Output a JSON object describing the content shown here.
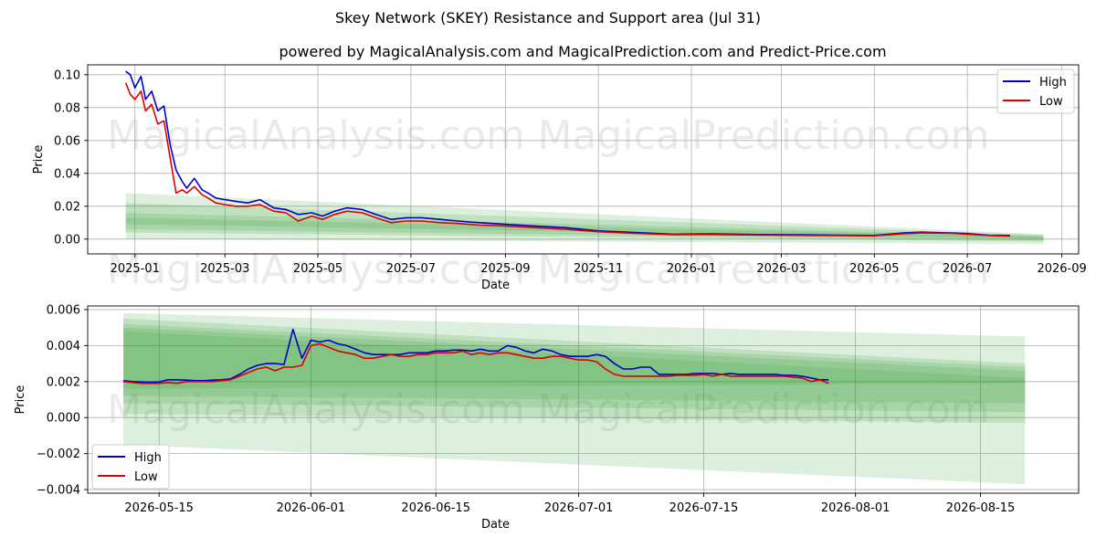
{
  "title": "Skey Network (SKEY) Resistance and Support area (Jul 31)",
  "subtitle": "powered by MagicalAnalysis.com and MagicalPrediction.com and Predict-Price.com",
  "watermarks": [
    "MagicalAnalysis.com",
    "MagicalPrediction.com"
  ],
  "colors": {
    "high": "#0000cc",
    "low": "#dd0000",
    "band": "#2e9a2e",
    "grid": "#b0b0b0"
  },
  "chart_data": [
    {
      "type": "line",
      "xlabel": "Date",
      "ylabel": "Price",
      "xlim": [
        "2024-12-01",
        "2026-09-12"
      ],
      "ylim": [
        -0.009,
        0.106
      ],
      "x_ticks": [
        "2025-01-01",
        "2025-03-01",
        "2025-05-01",
        "2025-07-01",
        "2025-09-01",
        "2025-11-01",
        "2026-01-01",
        "2026-03-01",
        "2026-05-01",
        "2026-07-01",
        "2026-09-01"
      ],
      "x_tick_labels": [
        "2025-01",
        "2025-03",
        "2025-05",
        "2025-07",
        "2025-09",
        "2025-11",
        "2026-01",
        "2026-03",
        "2026-05",
        "2026-07",
        "2026-09"
      ],
      "y_ticks": [
        0.0,
        0.02,
        0.04,
        0.06,
        0.08,
        0.1
      ],
      "y_tick_labels": [
        "0.00",
        "0.02",
        "0.04",
        "0.06",
        "0.08",
        "0.10"
      ],
      "grid": true,
      "legend": "upper right",
      "series": [
        {
          "name": "High",
          "color": "#0000cc",
          "x": [
            "2024-12-26",
            "2024-12-29",
            "2025-01-01",
            "2025-01-05",
            "2025-01-08",
            "2025-01-12",
            "2025-01-16",
            "2025-01-20",
            "2025-01-24",
            "2025-01-28",
            "2025-02-01",
            "2025-02-04",
            "2025-02-09",
            "2025-02-14",
            "2025-02-18",
            "2025-02-23",
            "2025-03-01",
            "2025-03-08",
            "2025-03-16",
            "2025-03-24",
            "2025-04-02",
            "2025-04-10",
            "2025-04-18",
            "2025-04-27",
            "2025-05-04",
            "2025-05-12",
            "2025-05-20",
            "2025-05-30",
            "2025-06-08",
            "2025-06-18",
            "2025-06-28",
            "2025-07-08",
            "2025-07-20",
            "2025-08-01",
            "2025-08-15",
            "2025-09-01",
            "2025-09-20",
            "2025-10-10",
            "2025-11-01",
            "2025-11-25",
            "2025-12-20",
            "2026-01-15",
            "2026-02-15",
            "2026-03-15",
            "2026-04-10",
            "2026-05-01",
            "2026-05-20",
            "2026-06-01",
            "2026-06-20",
            "2026-07-01",
            "2026-07-15",
            "2026-07-29"
          ],
          "values": [
            0.102,
            0.1,
            0.092,
            0.099,
            0.085,
            0.09,
            0.078,
            0.081,
            0.058,
            0.042,
            0.035,
            0.031,
            0.037,
            0.03,
            0.028,
            0.025,
            0.024,
            0.023,
            0.022,
            0.024,
            0.019,
            0.018,
            0.015,
            0.016,
            0.014,
            0.017,
            0.019,
            0.018,
            0.015,
            0.012,
            0.013,
            0.013,
            0.012,
            0.011,
            0.01,
            0.009,
            0.008,
            0.007,
            0.005,
            0.004,
            0.003,
            0.0032,
            0.0028,
            0.0026,
            0.0024,
            0.0022,
            0.0038,
            0.0042,
            0.0038,
            0.0034,
            0.0024,
            0.0022
          ]
        },
        {
          "name": "Low",
          "color": "#dd0000",
          "x": [
            "2024-12-26",
            "2024-12-29",
            "2025-01-01",
            "2025-01-05",
            "2025-01-08",
            "2025-01-12",
            "2025-01-16",
            "2025-01-20",
            "2025-01-24",
            "2025-01-28",
            "2025-02-01",
            "2025-02-04",
            "2025-02-09",
            "2025-02-14",
            "2025-02-18",
            "2025-02-23",
            "2025-03-01",
            "2025-03-08",
            "2025-03-16",
            "2025-03-24",
            "2025-04-02",
            "2025-04-10",
            "2025-04-18",
            "2025-04-27",
            "2025-05-04",
            "2025-05-12",
            "2025-05-20",
            "2025-05-30",
            "2025-06-08",
            "2025-06-18",
            "2025-06-28",
            "2025-07-08",
            "2025-07-20",
            "2025-08-01",
            "2025-08-15",
            "2025-09-01",
            "2025-09-20",
            "2025-10-10",
            "2025-11-01",
            "2025-11-25",
            "2025-12-20",
            "2026-01-15",
            "2026-02-15",
            "2026-03-15",
            "2026-04-10",
            "2026-05-01",
            "2026-05-20",
            "2026-06-01",
            "2026-06-20",
            "2026-07-01",
            "2026-07-15",
            "2026-07-29"
          ],
          "values": [
            0.095,
            0.088,
            0.085,
            0.09,
            0.078,
            0.082,
            0.07,
            0.072,
            0.05,
            0.028,
            0.03,
            0.028,
            0.032,
            0.027,
            0.025,
            0.022,
            0.021,
            0.02,
            0.02,
            0.021,
            0.017,
            0.016,
            0.011,
            0.014,
            0.012,
            0.015,
            0.017,
            0.016,
            0.013,
            0.01,
            0.011,
            0.011,
            0.01,
            0.0095,
            0.0085,
            0.008,
            0.007,
            0.006,
            0.0045,
            0.0035,
            0.0027,
            0.0028,
            0.0025,
            0.0023,
            0.0021,
            0.002,
            0.0033,
            0.0038,
            0.0035,
            0.003,
            0.0022,
            0.0019
          ]
        }
      ],
      "bands": [
        {
          "x": [
            "2024-12-26",
            "2026-08-20"
          ],
          "upper": [
            0.028,
            0.003
          ],
          "lower": [
            0.0,
            -0.003
          ]
        },
        {
          "x": [
            "2024-12-26",
            "2026-08-20"
          ],
          "upper": [
            0.022,
            0.0025
          ],
          "lower": [
            0.004,
            -0.0015
          ]
        },
        {
          "x": [
            "2024-12-26",
            "2026-08-20"
          ],
          "upper": [
            0.016,
            0.002
          ],
          "lower": [
            0.006,
            -0.0008
          ]
        },
        {
          "x": [
            "2024-12-26",
            "2026-08-20"
          ],
          "upper": [
            0.013,
            0.0016
          ],
          "lower": [
            0.009,
            0.0002
          ]
        }
      ]
    },
    {
      "type": "line",
      "xlabel": "Date",
      "ylabel": "Price",
      "xlim": [
        "2026-05-07",
        "2026-08-26"
      ],
      "ylim": [
        -0.0042,
        0.0062
      ],
      "x_ticks": [
        "2026-05-15",
        "2026-06-01",
        "2026-06-15",
        "2026-07-01",
        "2026-07-15",
        "2026-08-01",
        "2026-08-15"
      ],
      "x_tick_labels": [
        "2026-05-15",
        "2026-06-01",
        "2026-06-15",
        "2026-07-01",
        "2026-07-15",
        "2026-08-01",
        "2026-08-15"
      ],
      "y_ticks": [
        -0.004,
        -0.002,
        0.0,
        0.002,
        0.004,
        0.006
      ],
      "y_tick_labels": [
        "−0.004",
        "−0.002",
        "0.000",
        "0.002",
        "0.004",
        "0.006"
      ],
      "grid": true,
      "legend": "lower left",
      "series": [
        {
          "name": "High",
          "color": "#0000cc",
          "x": [
            "2026-05-11",
            "2026-05-12",
            "2026-05-13",
            "2026-05-14",
            "2026-05-15",
            "2026-05-16",
            "2026-05-17",
            "2026-05-18",
            "2026-05-19",
            "2026-05-20",
            "2026-05-21",
            "2026-05-22",
            "2026-05-23",
            "2026-05-24",
            "2026-05-25",
            "2026-05-26",
            "2026-05-27",
            "2026-05-28",
            "2026-05-29",
            "2026-05-30",
            "2026-05-31",
            "2026-06-01",
            "2026-06-02",
            "2026-06-03",
            "2026-06-04",
            "2026-06-05",
            "2026-06-06",
            "2026-06-07",
            "2026-06-08",
            "2026-06-09",
            "2026-06-10",
            "2026-06-11",
            "2026-06-12",
            "2026-06-13",
            "2026-06-14",
            "2026-06-15",
            "2026-06-16",
            "2026-06-17",
            "2026-06-18",
            "2026-06-19",
            "2026-06-20",
            "2026-06-21",
            "2026-06-22",
            "2026-06-23",
            "2026-06-24",
            "2026-06-25",
            "2026-06-26",
            "2026-06-27",
            "2026-06-28",
            "2026-06-29",
            "2026-06-30",
            "2026-07-01",
            "2026-07-02",
            "2026-07-03",
            "2026-07-04",
            "2026-07-05",
            "2026-07-06",
            "2026-07-07",
            "2026-07-08",
            "2026-07-09",
            "2026-07-10",
            "2026-07-11",
            "2026-07-12",
            "2026-07-13",
            "2026-07-14",
            "2026-07-15",
            "2026-07-16",
            "2026-07-17",
            "2026-07-18",
            "2026-07-19",
            "2026-07-20",
            "2026-07-21",
            "2026-07-22",
            "2026-07-23",
            "2026-07-24",
            "2026-07-25",
            "2026-07-26",
            "2026-07-27",
            "2026-07-28",
            "2026-07-29"
          ],
          "values": [
            0.00205,
            0.002,
            0.00198,
            0.00196,
            0.00198,
            0.0021,
            0.0021,
            0.00208,
            0.00205,
            0.00205,
            0.00208,
            0.0021,
            0.00215,
            0.0024,
            0.0027,
            0.0029,
            0.003,
            0.003,
            0.00295,
            0.0049,
            0.0033,
            0.0043,
            0.0042,
            0.0043,
            0.0041,
            0.004,
            0.0038,
            0.0036,
            0.0035,
            0.0035,
            0.0035,
            0.0035,
            0.0036,
            0.0036,
            0.0036,
            0.0037,
            0.0037,
            0.00375,
            0.00375,
            0.0037,
            0.0038,
            0.0037,
            0.0037,
            0.004,
            0.0039,
            0.0037,
            0.0036,
            0.0038,
            0.0037,
            0.0035,
            0.0034,
            0.0034,
            0.0034,
            0.0035,
            0.0034,
            0.003,
            0.0027,
            0.0027,
            0.0028,
            0.0028,
            0.0024,
            0.0024,
            0.0024,
            0.0024,
            0.00245,
            0.00245,
            0.00245,
            0.0024,
            0.00245,
            0.0024,
            0.0024,
            0.0024,
            0.0024,
            0.0024,
            0.00235,
            0.00235,
            0.0023,
            0.0022,
            0.0021,
            0.0021
          ]
        },
        {
          "name": "Low",
          "color": "#dd0000",
          "x": [
            "2026-05-11",
            "2026-05-12",
            "2026-05-13",
            "2026-05-14",
            "2026-05-15",
            "2026-05-16",
            "2026-05-17",
            "2026-05-18",
            "2026-05-19",
            "2026-05-20",
            "2026-05-21",
            "2026-05-22",
            "2026-05-23",
            "2026-05-24",
            "2026-05-25",
            "2026-05-26",
            "2026-05-27",
            "2026-05-28",
            "2026-05-29",
            "2026-05-30",
            "2026-05-31",
            "2026-06-01",
            "2026-06-02",
            "2026-06-03",
            "2026-06-04",
            "2026-06-05",
            "2026-06-06",
            "2026-06-07",
            "2026-06-08",
            "2026-06-09",
            "2026-06-10",
            "2026-06-11",
            "2026-06-12",
            "2026-06-13",
            "2026-06-14",
            "2026-06-15",
            "2026-06-16",
            "2026-06-17",
            "2026-06-18",
            "2026-06-19",
            "2026-06-20",
            "2026-06-21",
            "2026-06-22",
            "2026-06-23",
            "2026-06-24",
            "2026-06-25",
            "2026-06-26",
            "2026-06-27",
            "2026-06-28",
            "2026-06-29",
            "2026-06-30",
            "2026-07-01",
            "2026-07-02",
            "2026-07-03",
            "2026-07-04",
            "2026-07-05",
            "2026-07-06",
            "2026-07-07",
            "2026-07-08",
            "2026-07-09",
            "2026-07-10",
            "2026-07-11",
            "2026-07-12",
            "2026-07-13",
            "2026-07-14",
            "2026-07-15",
            "2026-07-16",
            "2026-07-17",
            "2026-07-18",
            "2026-07-19",
            "2026-07-20",
            "2026-07-21",
            "2026-07-22",
            "2026-07-23",
            "2026-07-24",
            "2026-07-25",
            "2026-07-26",
            "2026-07-27",
            "2026-07-28",
            "2026-07-29"
          ],
          "values": [
            0.002,
            0.00195,
            0.0019,
            0.0019,
            0.0019,
            0.00195,
            0.0019,
            0.002,
            0.002,
            0.002,
            0.002,
            0.00205,
            0.0021,
            0.0023,
            0.0025,
            0.0027,
            0.0028,
            0.0026,
            0.0028,
            0.0028,
            0.0029,
            0.004,
            0.0041,
            0.0039,
            0.0037,
            0.0036,
            0.0035,
            0.0033,
            0.0033,
            0.0034,
            0.0035,
            0.0034,
            0.0034,
            0.0035,
            0.0035,
            0.0036,
            0.0036,
            0.0036,
            0.0037,
            0.0035,
            0.0036,
            0.0035,
            0.0036,
            0.0036,
            0.0035,
            0.0034,
            0.0033,
            0.0033,
            0.0034,
            0.0034,
            0.0033,
            0.0032,
            0.0032,
            0.0031,
            0.0027,
            0.0024,
            0.0023,
            0.0023,
            0.0023,
            0.0023,
            0.0023,
            0.0023,
            0.00235,
            0.00235,
            0.00235,
            0.0024,
            0.0023,
            0.0024,
            0.0023,
            0.0023,
            0.0023,
            0.0023,
            0.0023,
            0.0023,
            0.0023,
            0.00225,
            0.0022,
            0.002,
            0.0021,
            0.0019
          ]
        }
      ],
      "bands": [
        {
          "x": [
            "2026-05-11",
            "2026-08-20"
          ],
          "upper": [
            0.0058,
            0.0045
          ],
          "lower": [
            -0.0015,
            -0.0037
          ]
        },
        {
          "x": [
            "2026-05-11",
            "2026-08-20"
          ],
          "upper": [
            0.0055,
            0.003
          ],
          "lower": [
            0.0002,
            -0.0003
          ]
        },
        {
          "x": [
            "2026-05-11",
            "2026-08-20"
          ],
          "upper": [
            0.0052,
            0.0028
          ],
          "lower": [
            0.0008,
            0.0003
          ]
        },
        {
          "x": [
            "2026-05-11",
            "2026-08-20"
          ],
          "upper": [
            0.005,
            0.0026
          ],
          "lower": [
            0.0012,
            0.0008
          ]
        },
        {
          "x": [
            "2026-05-11",
            "2026-08-20"
          ],
          "upper": [
            0.0048,
            0.0022
          ],
          "lower": [
            0.0016,
            0.0019
          ]
        }
      ]
    }
  ]
}
